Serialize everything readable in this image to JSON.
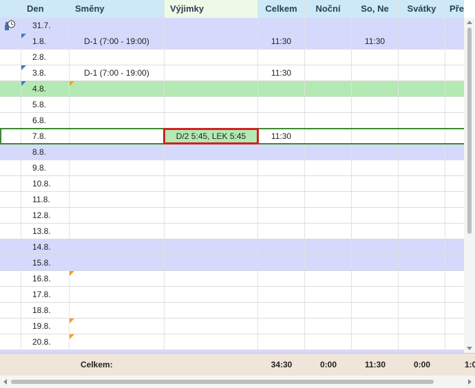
{
  "columns": {
    "day": "Den",
    "shifts": "Směny",
    "exceptions": "Výjimky",
    "total": "Celkem",
    "night": "Noční",
    "weekend": "So, Ne",
    "holidays": "Svátky",
    "overtime": "Přest"
  },
  "rows": [
    {
      "day": "31.7.",
      "shift": "",
      "exception": "",
      "total": "",
      "night": "",
      "weekend": "",
      "holidays": ""
    },
    {
      "day": "1.8.",
      "shift": "D-1 (7:00 - 19:00)",
      "exception": "",
      "total": "11:30",
      "night": "",
      "weekend": "11:30",
      "holidays": ""
    },
    {
      "day": "2.8.",
      "shift": "",
      "exception": "",
      "total": "",
      "night": "",
      "weekend": "",
      "holidays": ""
    },
    {
      "day": "3.8.",
      "shift": "D-1 (7:00 - 19:00)",
      "exception": "",
      "total": "11:30",
      "night": "",
      "weekend": "",
      "holidays": ""
    },
    {
      "day": "4.8.",
      "shift": "",
      "exception": "",
      "total": "",
      "night": "",
      "weekend": "",
      "holidays": ""
    },
    {
      "day": "5.8.",
      "shift": "",
      "exception": "",
      "total": "",
      "night": "",
      "weekend": "",
      "holidays": ""
    },
    {
      "day": "6.8.",
      "shift": "",
      "exception": "",
      "total": "",
      "night": "",
      "weekend": "",
      "holidays": ""
    },
    {
      "day": "7.8.",
      "shift": "",
      "exception": "D/2 5:45, LEK 5:45",
      "total": "11:30",
      "night": "",
      "weekend": "",
      "holidays": ""
    },
    {
      "day": "8.8.",
      "shift": "",
      "exception": "",
      "total": "",
      "night": "",
      "weekend": "",
      "holidays": ""
    },
    {
      "day": "9.8.",
      "shift": "",
      "exception": "",
      "total": "",
      "night": "",
      "weekend": "",
      "holidays": ""
    },
    {
      "day": "10.8.",
      "shift": "",
      "exception": "",
      "total": "",
      "night": "",
      "weekend": "",
      "holidays": ""
    },
    {
      "day": "11.8.",
      "shift": "",
      "exception": "",
      "total": "",
      "night": "",
      "weekend": "",
      "holidays": ""
    },
    {
      "day": "12.8.",
      "shift": "",
      "exception": "",
      "total": "",
      "night": "",
      "weekend": "",
      "holidays": ""
    },
    {
      "day": "13.8.",
      "shift": "",
      "exception": "",
      "total": "",
      "night": "",
      "weekend": "",
      "holidays": ""
    },
    {
      "day": "14.8.",
      "shift": "",
      "exception": "",
      "total": "",
      "night": "",
      "weekend": "",
      "holidays": ""
    },
    {
      "day": "15.8.",
      "shift": "",
      "exception": "",
      "total": "",
      "night": "",
      "weekend": "",
      "holidays": ""
    },
    {
      "day": "16.8.",
      "shift": "",
      "exception": "",
      "total": "",
      "night": "",
      "weekend": "",
      "holidays": ""
    },
    {
      "day": "17.8.",
      "shift": "",
      "exception": "",
      "total": "",
      "night": "",
      "weekend": "",
      "holidays": ""
    },
    {
      "day": "18.8.",
      "shift": "",
      "exception": "",
      "total": "",
      "night": "",
      "weekend": "",
      "holidays": ""
    },
    {
      "day": "19.8.",
      "shift": "",
      "exception": "",
      "total": "",
      "night": "",
      "weekend": "",
      "holidays": ""
    },
    {
      "day": "20.8.",
      "shift": "",
      "exception": "",
      "total": "",
      "night": "",
      "weekend": "",
      "holidays": ""
    }
  ],
  "footer": {
    "label": "Celkem:",
    "total": "34:30",
    "night": "0:00",
    "weekend": "11:30",
    "holidays": "0:00",
    "overtime": "1:0"
  },
  "colors": {
    "header_bg": "#cde8f7",
    "row_blue": "#d5d9fb",
    "row_green": "#b3e9b3",
    "footer_bg": "#efe5d8",
    "selection_border": "#3a8a2e",
    "exception_border": "#d22020"
  }
}
